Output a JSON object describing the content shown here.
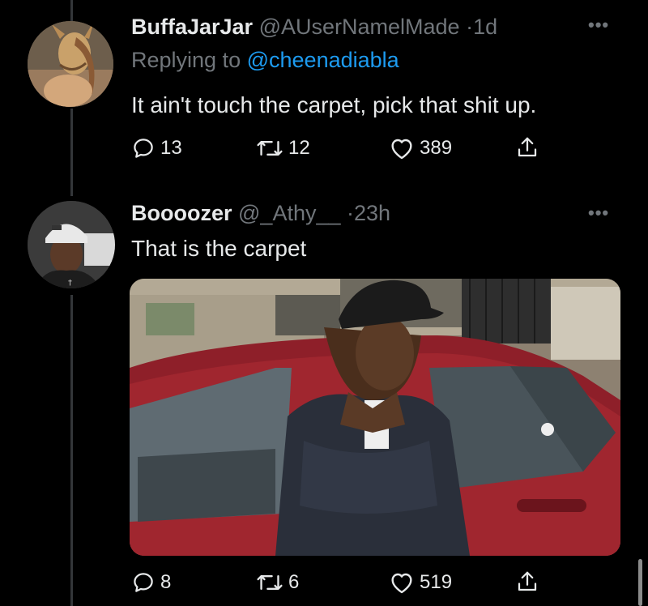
{
  "tweets": [
    {
      "display_name": "BuffaJarJar",
      "handle": "@AUserNamelMade",
      "separator": "·",
      "time": "1d",
      "replying_prefix": "Replying to",
      "replying_to": "@cheenadiabla",
      "text": "It ain't touch the carpet, pick that shit up.",
      "replies": "13",
      "retweets": "12",
      "likes": "389"
    },
    {
      "display_name": "Boooozer",
      "handle": "@_Athy__",
      "separator": "·",
      "time": "23h",
      "text": "That is the carpet",
      "replies": "8",
      "retweets": "6",
      "likes": "519"
    }
  ],
  "icons": {
    "reply": "reply-icon",
    "retweet": "retweet-icon",
    "like": "like-icon",
    "share": "share-icon",
    "more": "more-icon"
  },
  "colors": {
    "background": "#000000",
    "text": "#e7e9ea",
    "muted": "#71767b",
    "accent": "#1d9bf0",
    "car": "#8e1f29"
  }
}
